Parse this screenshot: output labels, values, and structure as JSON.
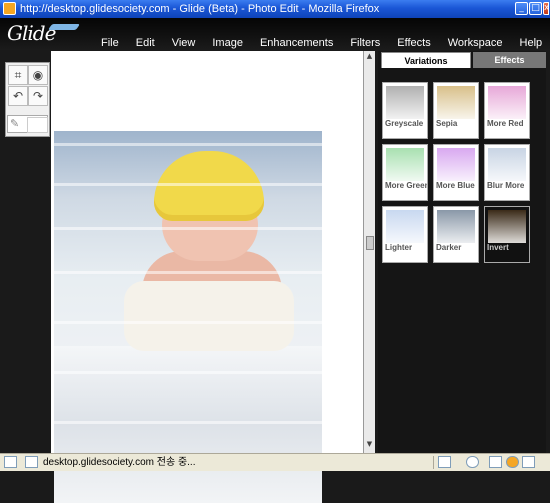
{
  "window": {
    "title": "http://desktop.glidesociety.com - Glide (Beta) - Photo Edit - Mozilla Firefox",
    "minimize_glyph": "_",
    "maximize_glyph": "□",
    "close_glyph": "x"
  },
  "app": {
    "logo": "Glide",
    "menu": [
      "File",
      "Edit",
      "View",
      "Image",
      "Enhancements",
      "Filters",
      "Effects",
      "Workspace",
      "Help"
    ]
  },
  "tools": {
    "icons": [
      "crop-icon",
      "eye-icon",
      "undo-icon",
      "redo-icon"
    ],
    "glyphs": [
      "⌗",
      "◉",
      "↶",
      "↷",
      "✎"
    ]
  },
  "variations_panel": {
    "tabs": [
      "Variations",
      "Effects"
    ],
    "active_tab": "Variations",
    "thumbnails": [
      {
        "label": "Greyscale",
        "tint": "#b0b0b0"
      },
      {
        "label": "Sepia",
        "tint": "#d8c08a"
      },
      {
        "label": "More Red",
        "tint": "#e7a8d8"
      },
      {
        "label": "More Green",
        "tint": "#a8e0b0"
      },
      {
        "label": "More Blue",
        "tint": "#d8a8f0"
      },
      {
        "label": "Blur More",
        "tint": "#c8d4e4"
      },
      {
        "label": "Lighter",
        "tint": "#c8d8f0"
      },
      {
        "label": "Darker",
        "tint": "#8a98a8"
      },
      {
        "label": "Invert",
        "tint": "#3a2a18"
      }
    ]
  },
  "status": {
    "text": "desktop.glidesociety.com 전송 중..."
  },
  "colors": {
    "title_bar": "#1a56d6",
    "app_background": "#1a1a1a",
    "hat_yellow": "#f1d94a"
  }
}
